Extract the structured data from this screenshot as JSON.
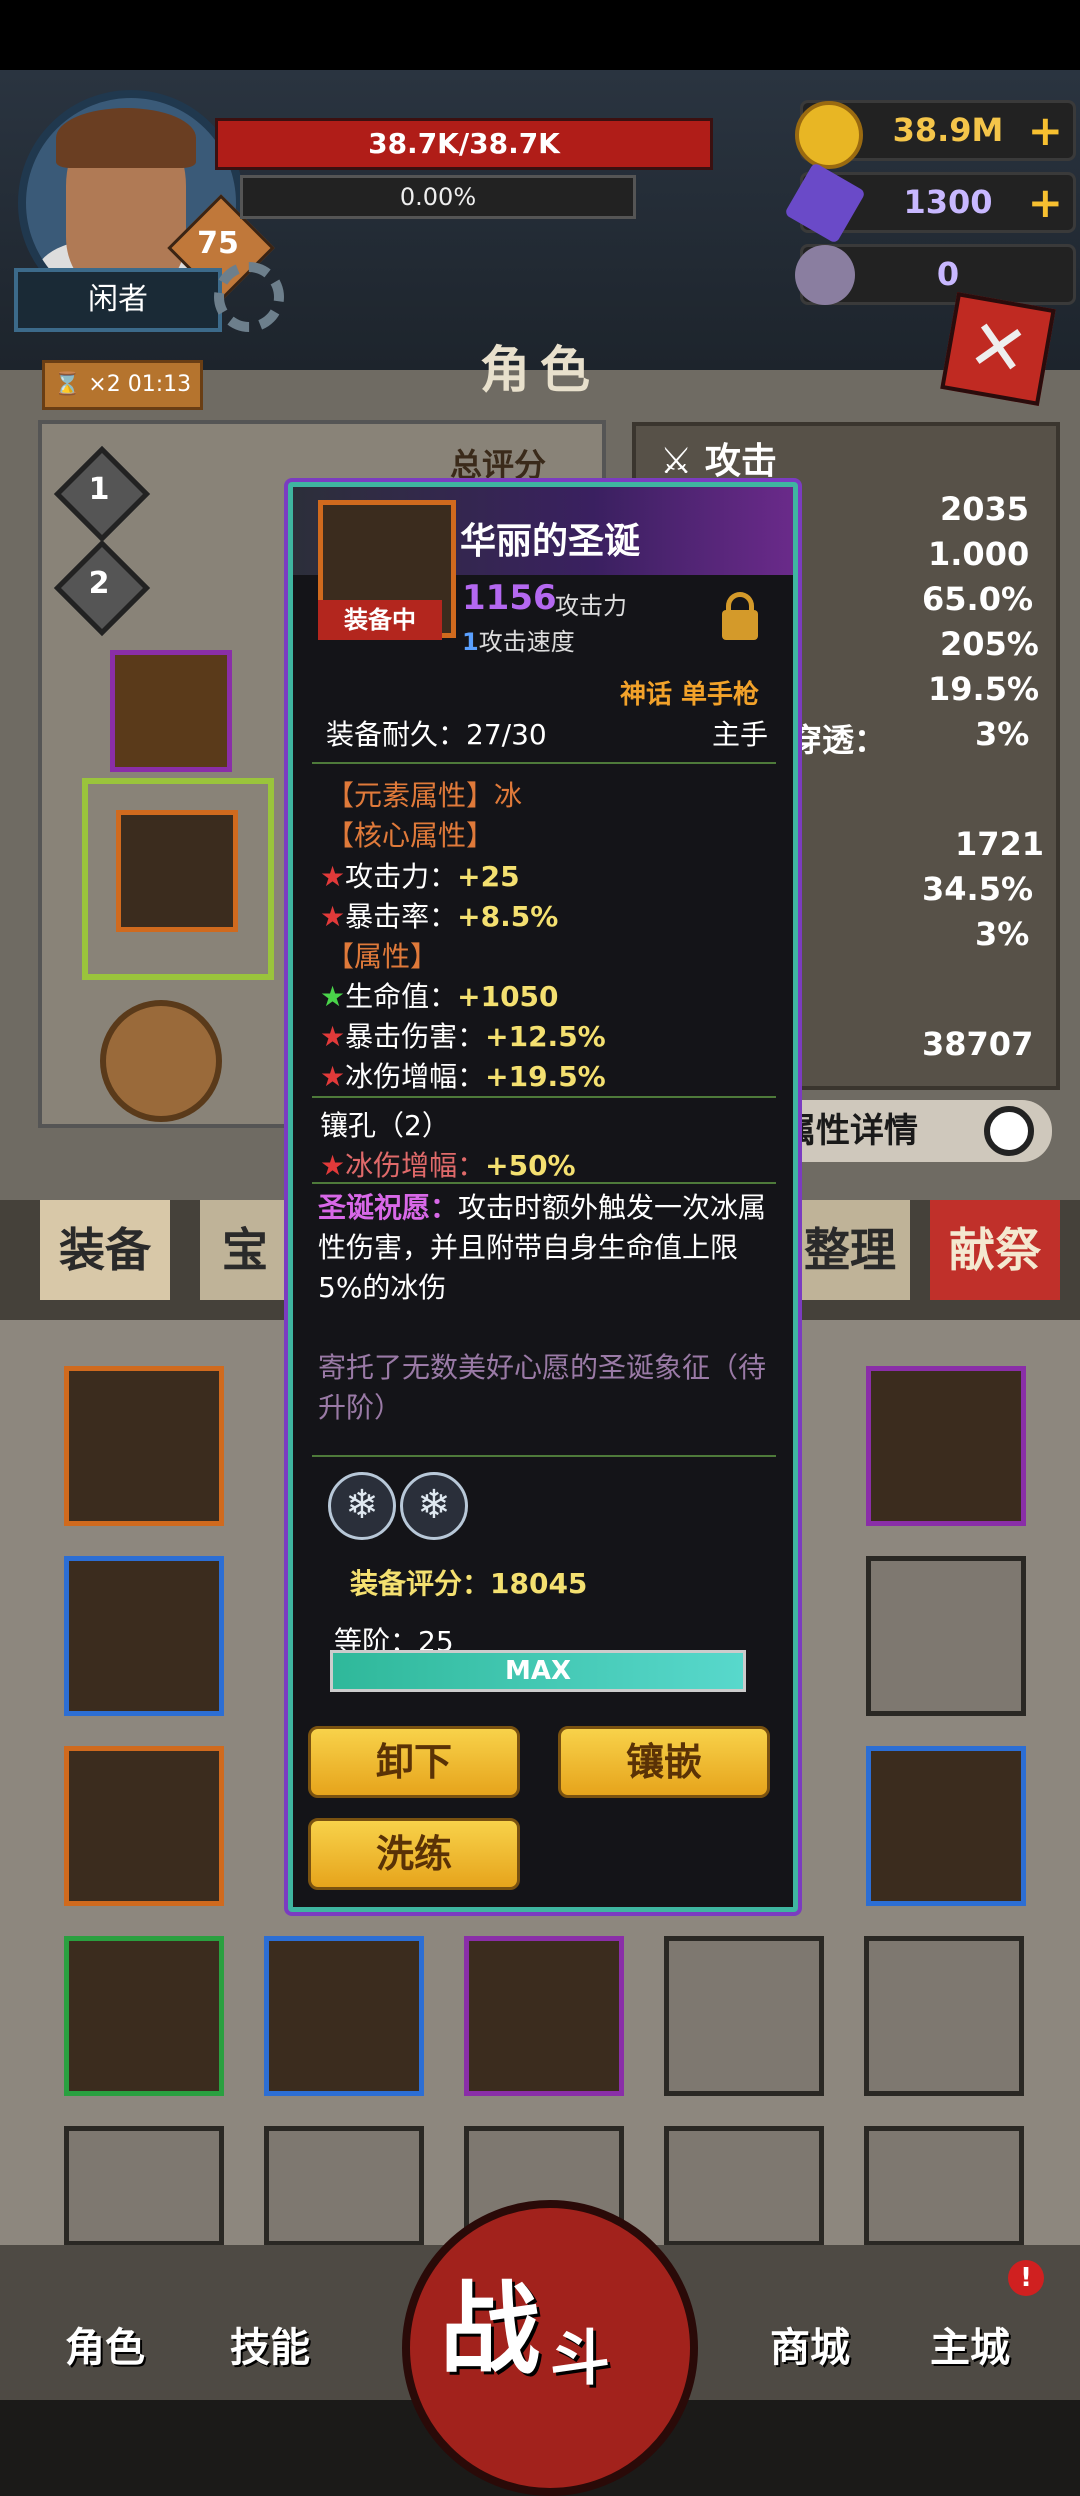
{
  "player": {
    "name": "闲者",
    "level": "75",
    "hp": "38.7K/38.7K",
    "exp": "0.00%"
  },
  "resources": {
    "gold": "38.9M",
    "gems": "1300",
    "other": "0",
    "plus": "+"
  },
  "page": {
    "title": "角色",
    "close": "✕"
  },
  "buff": {
    "mult": "×2",
    "time": "01:13"
  },
  "loadouts": [
    "1",
    "2"
  ],
  "left_panel": {
    "total_score_label": "总评分"
  },
  "stats_panel": {
    "header": "攻击",
    "values": [
      "2035",
      "1.000",
      "65.0%",
      "205%",
      "19.5%",
      "3%",
      "1721",
      "34.5%",
      "3%",
      "38707"
    ],
    "visible_label": "穿透：",
    "detail_button": "属性详情"
  },
  "tabs": {
    "equip": "装备",
    "gem": "宝石",
    "sort": "整理",
    "sacrifice": "献祭"
  },
  "bottom_nav": {
    "role": "角色",
    "skill": "技能",
    "battle1": "战",
    "battle2": "斗",
    "shop": "商城",
    "city": "主城",
    "badge": "!"
  },
  "popup": {
    "name": "华丽的圣诞",
    "equipped": "装备中",
    "attack_value": "1156",
    "attack_label": "攻击力",
    "speed_value": "1",
    "speed_label": "攻击速度",
    "quality": "神话 单手枪",
    "durability": "装备耐久：27/30",
    "hand": "主手",
    "element_line": "【元素属性】冰",
    "core_header": "【核心属性】",
    "core_stats": [
      {
        "label": "攻击力：",
        "value": "+25"
      },
      {
        "label": "暴击率：",
        "value": "+8.5%"
      }
    ],
    "attr_header": "【属性】",
    "attrs": [
      {
        "label": "生命值：",
        "value": "+1050"
      },
      {
        "label": "暴击伤害：",
        "value": "+12.5%"
      },
      {
        "label": "冰伤增幅：",
        "value": "+19.5%"
      }
    ],
    "socket_title": "镶孔（2）",
    "socket_stat": {
      "label": "冰伤增幅：",
      "value": "+50%"
    },
    "skill_name": "圣诞祝愿：",
    "skill_desc": "攻击时额外触发一次冰属性伤害，并且附带自身生命值上限5%的冰伤",
    "flavor": "寄托了无数美好心愿的圣诞象征（待升阶）",
    "gem_glyph": "❄",
    "score": "装备评分：18045",
    "grade": "等阶：25",
    "max": "MAX",
    "btn_unequip": "卸下",
    "btn_inlay": "镶嵌",
    "btn_refine": "洗练",
    "star": "★"
  }
}
